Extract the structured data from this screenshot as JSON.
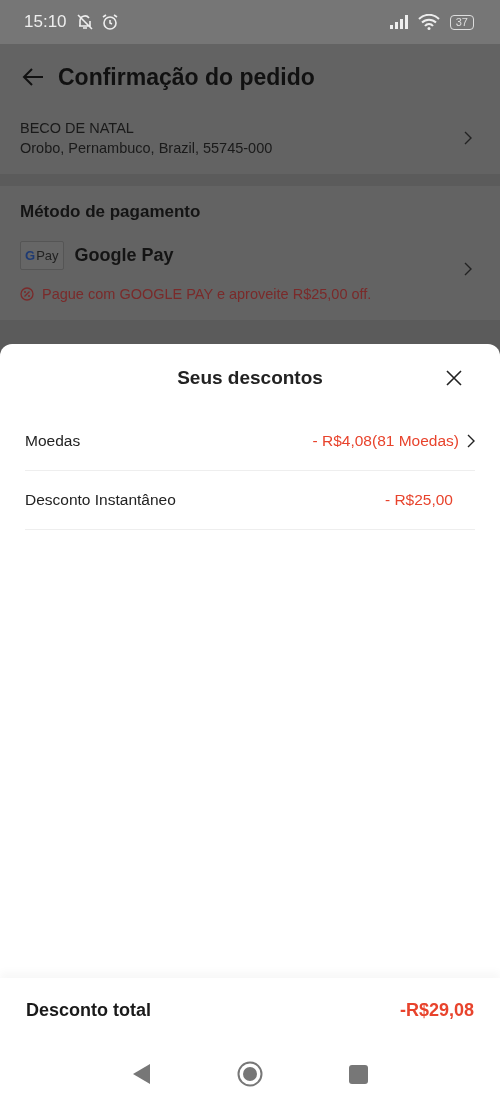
{
  "status_bar": {
    "time": "15:10",
    "battery": "37"
  },
  "header": {
    "title": "Confirmação do pedido"
  },
  "address": {
    "lines": [
      "BECO DE NATAL",
      "Orobo, Pernambuco, Brazil, 55745-000"
    ]
  },
  "payment": {
    "heading": "Método de pagamento",
    "logo_mark": "G",
    "logo_text": "Pay",
    "method": "Google Pay",
    "promo": "Pague com GOOGLE PAY e aproveite R$25,00 off."
  },
  "sheet": {
    "title": "Seus descontos",
    "rows": [
      {
        "label": "Moedas",
        "value": "- R$4,08(81 Moedas)",
        "has_arrow": true
      },
      {
        "label": "Desconto Instantâneo",
        "value": "- R$25,00",
        "has_arrow": false
      }
    ],
    "total_label": "Desconto total",
    "total_value": "-R$29,08"
  }
}
